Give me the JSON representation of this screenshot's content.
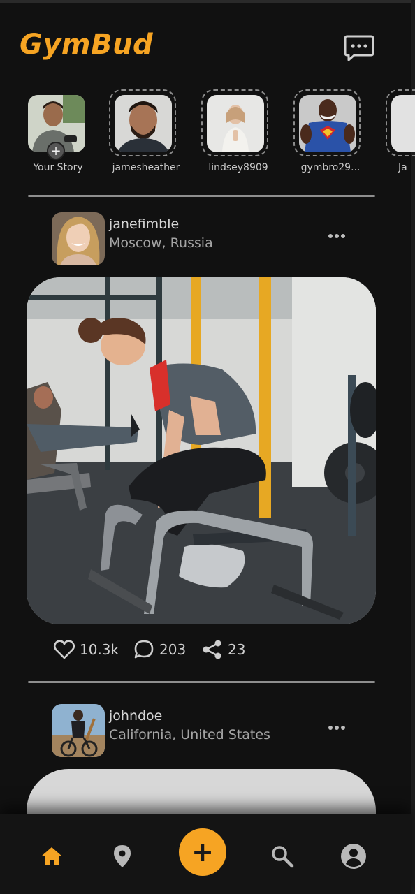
{
  "app": {
    "title": "GymBud",
    "accent": "#f6a423"
  },
  "header": {
    "messages_icon": "chat-bubble-icon"
  },
  "stories": [
    {
      "label": "Your Story",
      "own": true
    },
    {
      "label": "jamesheather"
    },
    {
      "label": "lindsey8909"
    },
    {
      "label": "gymbro29..."
    },
    {
      "label": "Ja"
    }
  ],
  "posts": [
    {
      "username": "janefimble",
      "location": "Moscow, Russia",
      "likes": "10.3k",
      "comments": "203",
      "shares": "23"
    },
    {
      "username": "johndoe",
      "location": "California, United States"
    }
  ],
  "nav": {
    "items": [
      "home-icon",
      "location-pin-icon",
      "add-icon",
      "search-icon",
      "profile-icon"
    ],
    "active": "home-icon",
    "add_label": "+"
  }
}
